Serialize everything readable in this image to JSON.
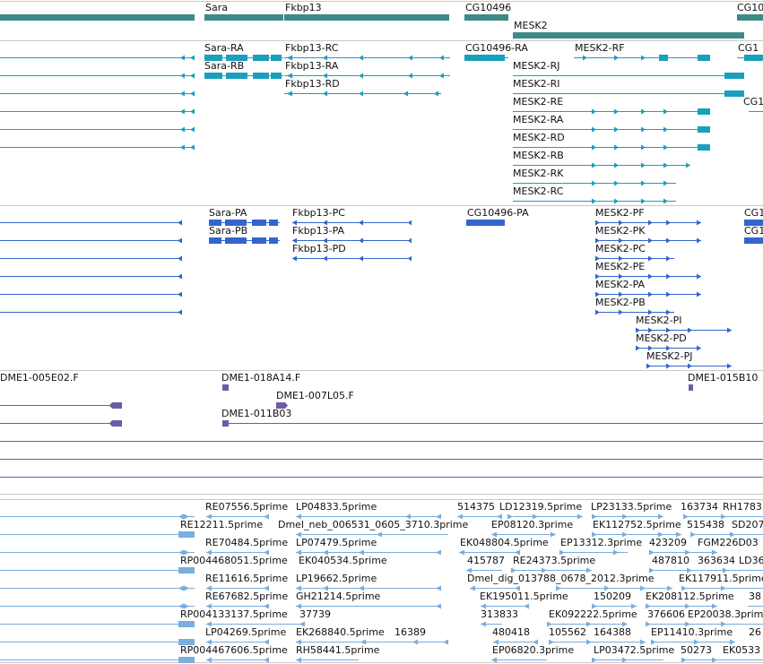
{
  "colors": {
    "gene": "#3d8a86",
    "transcript": "#1a9fbd",
    "protein": "#3366cc",
    "clone": "#6f5aa6",
    "est": "#79aedd",
    "separator": "#c8c8c8"
  },
  "tracks": {
    "genes": {
      "labels": [
        "Sara",
        "Fkbp13",
        "CG10496",
        "MESK2",
        "CG10"
      ]
    },
    "transcripts": {
      "labels": [
        "Sara-RA",
        "Sara-RB",
        "Fkbp13-RC",
        "Fkbp13-RA",
        "Fkbp13-RD",
        "CG10496-RA",
        "MESK2-RF",
        "MESK2-RJ",
        "MESK2-RI",
        "MESK2-RE",
        "MESK2-RA",
        "MESK2-RD",
        "MESK2-RB",
        "MESK2-RK",
        "MESK2-RC",
        "CG1",
        "CG1"
      ]
    },
    "proteins": {
      "labels": [
        "Sara-PA",
        "Sara-PB",
        "Fkbp13-PC",
        "Fkbp13-PA",
        "Fkbp13-PD",
        "CG10496-PA",
        "MESK2-PF",
        "MESK2-PK",
        "MESK2-PC",
        "MESK2-PE",
        "MESK2-PA",
        "MESK2-PB",
        "MESK2-PI",
        "MESK2-PD",
        "MESK2-PJ",
        "CG1",
        "CG1"
      ]
    },
    "clones": {
      "labels": [
        "DME1-005E02.F",
        "DME1-018A14.F",
        "DME1-007L05.F",
        "DME1-011B03",
        "DME1-015B10"
      ]
    },
    "ests": {
      "labels": [
        "RE07556.5prime",
        "LP04833.5prime",
        "514375",
        "LD12319.5prime",
        "LP23133.5prime",
        "163734",
        "RH1783",
        "RE12211.5prime",
        "Dmel_neb_006531_0605_3710.3prime",
        "EP08120.3prime",
        "EK112752.5prime",
        "515438",
        "SD207",
        "RE70484.5prime",
        "LP07479.5prime",
        "EK048804.5prime",
        "EP13312.3prime",
        "423209",
        "FGM226D03",
        "RP004468051.5prime",
        "EK040534.5prime",
        "415787",
        "RE24373.5prime",
        "487810",
        "363634",
        "LD36",
        "RE11616.5prime",
        "LP19662.5prime",
        "Dmel_dig_013788_0678_2012.3prime",
        "EK117911.5prime",
        "RE67682.5prime",
        "GH21214.5prime",
        "EK195011.5prime",
        "150209",
        "EK208112.5prime",
        "38",
        "RP004133137.5prime",
        "37739",
        "313833",
        "EK092222.5prime",
        "376606",
        "EP20038.3prime",
        "LP04269.5prime",
        "EK268840.5prime",
        "16389",
        "480418",
        "105562",
        "164388",
        "EP11410.3prime",
        "26",
        "RP004467606.5prime",
        "RH58441.5prime",
        "EP06820.3prime",
        "LP03472.5prime",
        "50273",
        "EK0533"
      ]
    }
  }
}
